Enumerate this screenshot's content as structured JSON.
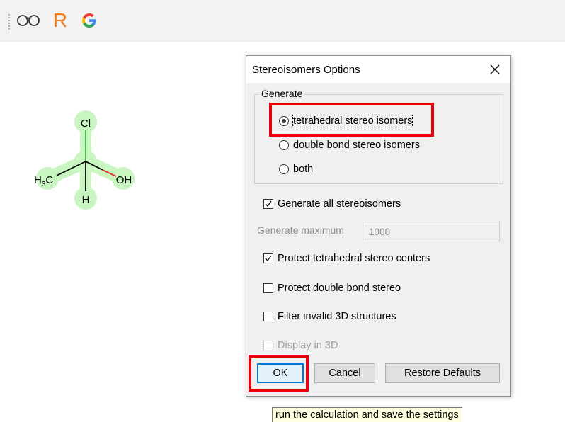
{
  "toolbar": {
    "icons": [
      "glasses-icon",
      "r-logo-icon",
      "google-logo-icon"
    ],
    "r_label": "R"
  },
  "molecule": {
    "atoms": {
      "top": "Cl",
      "left_main": "H",
      "left_sub": "3",
      "left_tail": "C",
      "right": "OH",
      "bottom": "H"
    },
    "colors": {
      "highlight": "#c8f5c0",
      "bond": "#000000",
      "oxygen_bond": "#e5332a",
      "chlorine_bond": "#3cb43c"
    }
  },
  "dialog": {
    "title": "Stereoisomers Options",
    "close_glyph": "✕",
    "generate_group": {
      "legend": "Generate",
      "options": [
        {
          "label": "tetrahedral stereo isomers",
          "checked": true
        },
        {
          "label": "double bond stereo isomers",
          "checked": false
        },
        {
          "label": "both",
          "checked": false
        }
      ]
    },
    "generate_all": {
      "label": "Generate all stereoisomers",
      "checked": true
    },
    "generate_maximum": {
      "label": "Generate maximum",
      "value": "1000"
    },
    "protect_tetrahedral": {
      "label": "Protect tetrahedral stereo centers",
      "checked": true
    },
    "protect_double_bond": {
      "label": "Protect double bond stereo",
      "checked": false
    },
    "filter_invalid": {
      "label": "Filter invalid 3D structures",
      "checked": false
    },
    "display_3d": {
      "label": "Display in 3D",
      "checked": false,
      "disabled": true
    },
    "buttons": {
      "ok": "OK",
      "cancel": "Cancel",
      "restore": "Restore Defaults"
    }
  },
  "tooltip": "run the calculation and save the settings",
  "colors": {
    "highlight_box": "#e8000d",
    "ok_focus": "#0078d7"
  }
}
